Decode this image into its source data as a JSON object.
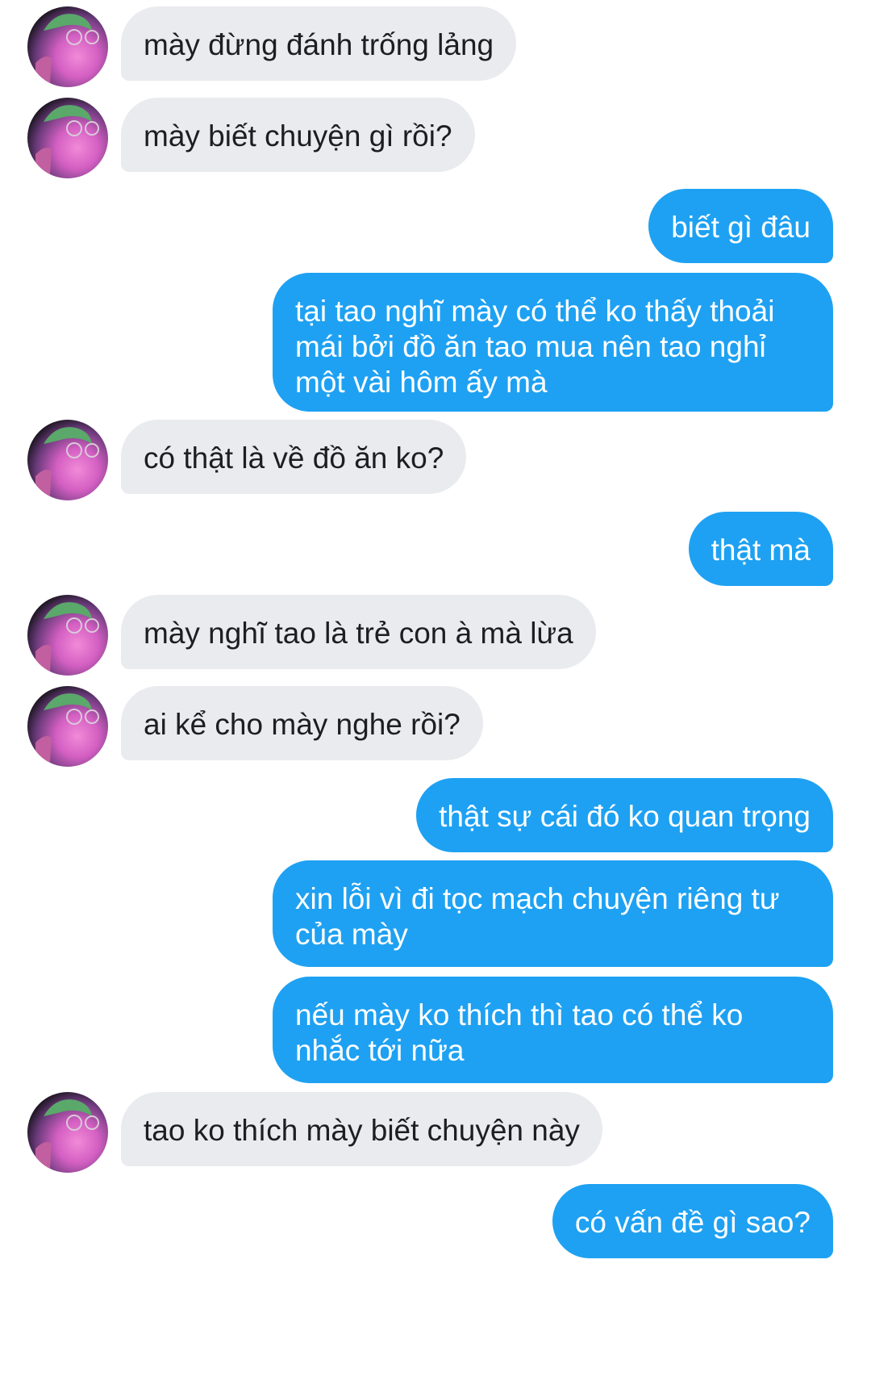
{
  "conversation": {
    "messages": [
      {
        "side": "in",
        "text": "mày đừng đánh trống lảng"
      },
      {
        "side": "in",
        "text": "mày biết chuyện gì rồi?"
      },
      {
        "side": "out",
        "text": "biết gì đâu"
      },
      {
        "side": "out",
        "text": "tại tao nghĩ mày có thể ko thấy thoải mái bởi đồ ăn tao mua nên tao nghỉ một vài hôm ấy mà"
      },
      {
        "side": "in",
        "text": "có thật là về đồ ăn ko?"
      },
      {
        "side": "out",
        "text": "thật mà"
      },
      {
        "side": "in",
        "text": "mày nghĩ tao là trẻ con à mà lừa"
      },
      {
        "side": "in",
        "text": "ai kể cho mày nghe rồi?"
      },
      {
        "side": "out",
        "text": "thật sự cái đó ko quan trọng"
      },
      {
        "side": "out",
        "text": "xin lỗi vì đi tọc mạch chuyện riêng tư của mày"
      },
      {
        "side": "out",
        "text": "nếu mày ko thích thì tao có thể ko nhắc tới nữa"
      },
      {
        "side": "in",
        "text": "tao ko thích mày biết chuyện này"
      },
      {
        "side": "out",
        "text": "có vấn đề gì sao?"
      }
    ]
  },
  "colors": {
    "incoming_bubble": "#e9ebee",
    "outgoing_bubble": "#1ea1f2",
    "incoming_text": "#1c1e21",
    "outgoing_text": "#ffffff"
  },
  "icons": {
    "avatar": "profile-photo-avatar"
  }
}
